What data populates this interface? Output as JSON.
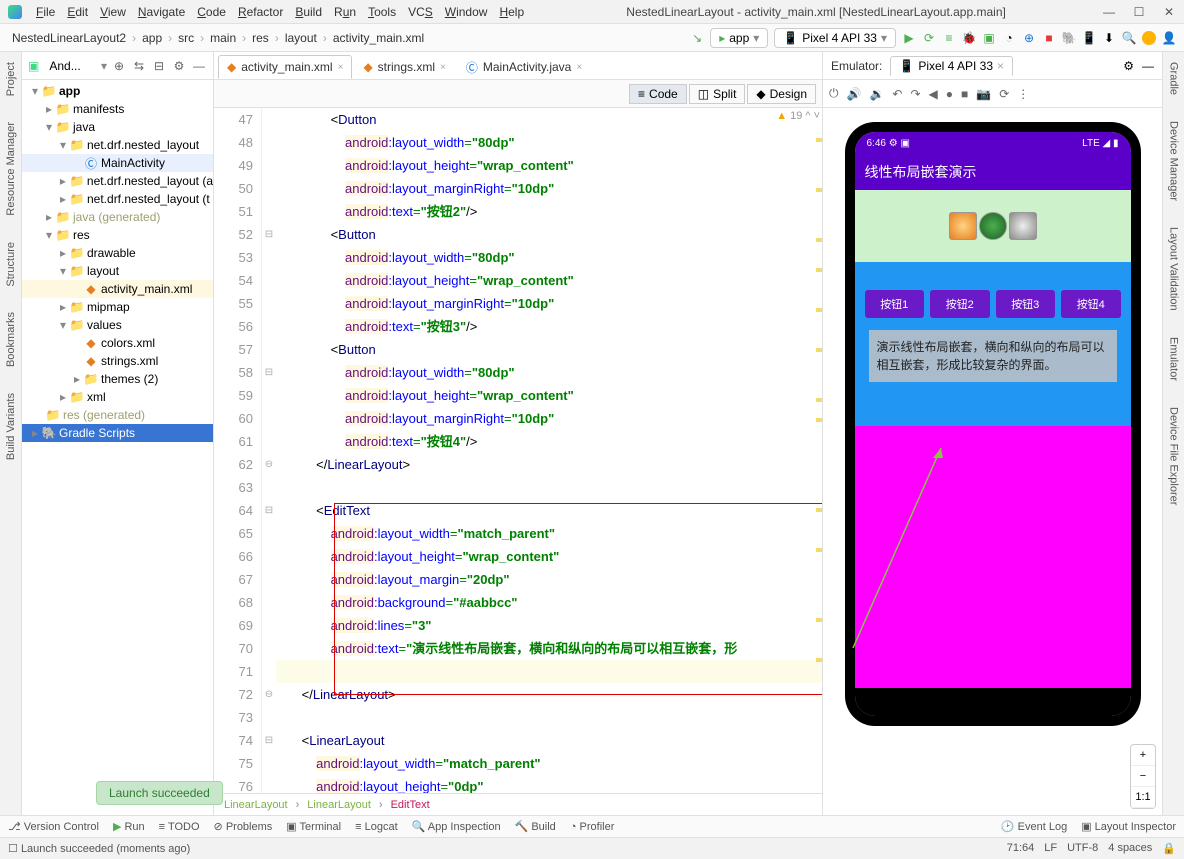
{
  "menu": {
    "items": [
      "File",
      "Edit",
      "View",
      "Navigate",
      "Code",
      "Refactor",
      "Build",
      "Run",
      "Tools",
      "VCS",
      "Window",
      "Help"
    ],
    "title": "NestedLinearLayout - activity_main.xml [NestedLinearLayout.app.main]"
  },
  "breadcrumbs": [
    "NestedLinearLayout2",
    "app",
    "src",
    "main",
    "res",
    "layout",
    "activity_main.xml"
  ],
  "toolbar": {
    "runconfig": "app",
    "device": "Pixel 4 API 33"
  },
  "sidepanel": {
    "label": "And..."
  },
  "tree": {
    "app": "app",
    "manifests": "manifests",
    "java": "java",
    "pkg1": "net.drf.nested_layout",
    "mainactivity": "MainActivity",
    "pkg2": "net.drf.nested_layout (a",
    "pkg3": "net.drf.nested_layout (t",
    "javagen": "java (generated)",
    "res": "res",
    "drawable": "drawable",
    "layout": "layout",
    "actxml": "activity_main.xml",
    "mipmap": "mipmap",
    "values": "values",
    "colors": "colors.xml",
    "strings": "strings.xml",
    "themes": "themes (2)",
    "xml": "xml",
    "resgen": "res (generated)",
    "gradle": "Gradle Scripts"
  },
  "tabs": [
    {
      "label": "activity_main.xml",
      "active": true
    },
    {
      "label": "strings.xml",
      "active": false
    },
    {
      "label": "MainActivity.java",
      "active": false
    }
  ],
  "codeModes": {
    "code": "Code",
    "split": "Split",
    "design": "Design"
  },
  "warning": {
    "count": "19"
  },
  "lines": {
    "start": 47
  },
  "code": {
    "button": "Button",
    "linearlayout": "LinearLayout",
    "edittext": "EditText",
    "ns": "android",
    "lw": "layout_width",
    "lh": "layout_height",
    "lmr": "layout_marginRight",
    "lm": "layout_margin",
    "bg": "background",
    "ln": "lines",
    "txt": "text",
    "v80": "\"80dp\"",
    "vwrap": "\"wrap_content\"",
    "v10": "\"10dp\"",
    "v20": "\"20dp\"",
    "vmatch": "\"match_parent\"",
    "v0": "\"0dp\"",
    "vaabbcc": "\"#aabbcc\"",
    "v3": "\"3\"",
    "btn2": "\"按钮2\"",
    "btn3": "\"按钮3\"",
    "btn4": "\"按钮4\"",
    "edittext_val": "\"演示线性布局嵌套，横向和纵向的布局可以相互嵌套，形"
  },
  "bottomBreadcrumb": {
    "ll1": "LinearLayout",
    "ll2": "LinearLayout",
    "et": "EditText"
  },
  "emulator": {
    "label": "Emulator:",
    "device": "Pixel 4 API 33"
  },
  "phone": {
    "time": "6:46",
    "signal": "LTE",
    "title": "线性布局嵌套演示",
    "btns": [
      "按钮1",
      "按钮2",
      "按钮3",
      "按钮4"
    ],
    "edit": "演示线性布局嵌套，横向和纵向的布局可以相互嵌套，形成比较复杂的界面。"
  },
  "zoom": {
    "plus": "+",
    "minus": "−",
    "fit": "1:1"
  },
  "leftBars": [
    "Project",
    "Resource Manager",
    "Structure",
    "Bookmarks",
    "Build Variants"
  ],
  "rightBars": [
    "Gradle",
    "Device Manager",
    "Layout Validation",
    "Emulator",
    "Device File Explorer"
  ],
  "bottomStrip": {
    "vc": "Version Control",
    "run": "Run",
    "todo": "TODO",
    "problems": "Problems",
    "terminal": "Terminal",
    "logcat": "Logcat",
    "appinsp": "App Inspection",
    "build": "Build",
    "profiler": "Profiler",
    "eventlog": "Event Log",
    "layoutinsp": "Layout Inspector"
  },
  "statusbar": {
    "msg": "Launch succeeded (moments ago)",
    "pos": "71:64",
    "le": "LF",
    "enc": "UTF-8",
    "indent": "4 spaces"
  },
  "toast": "Launch succeeded"
}
